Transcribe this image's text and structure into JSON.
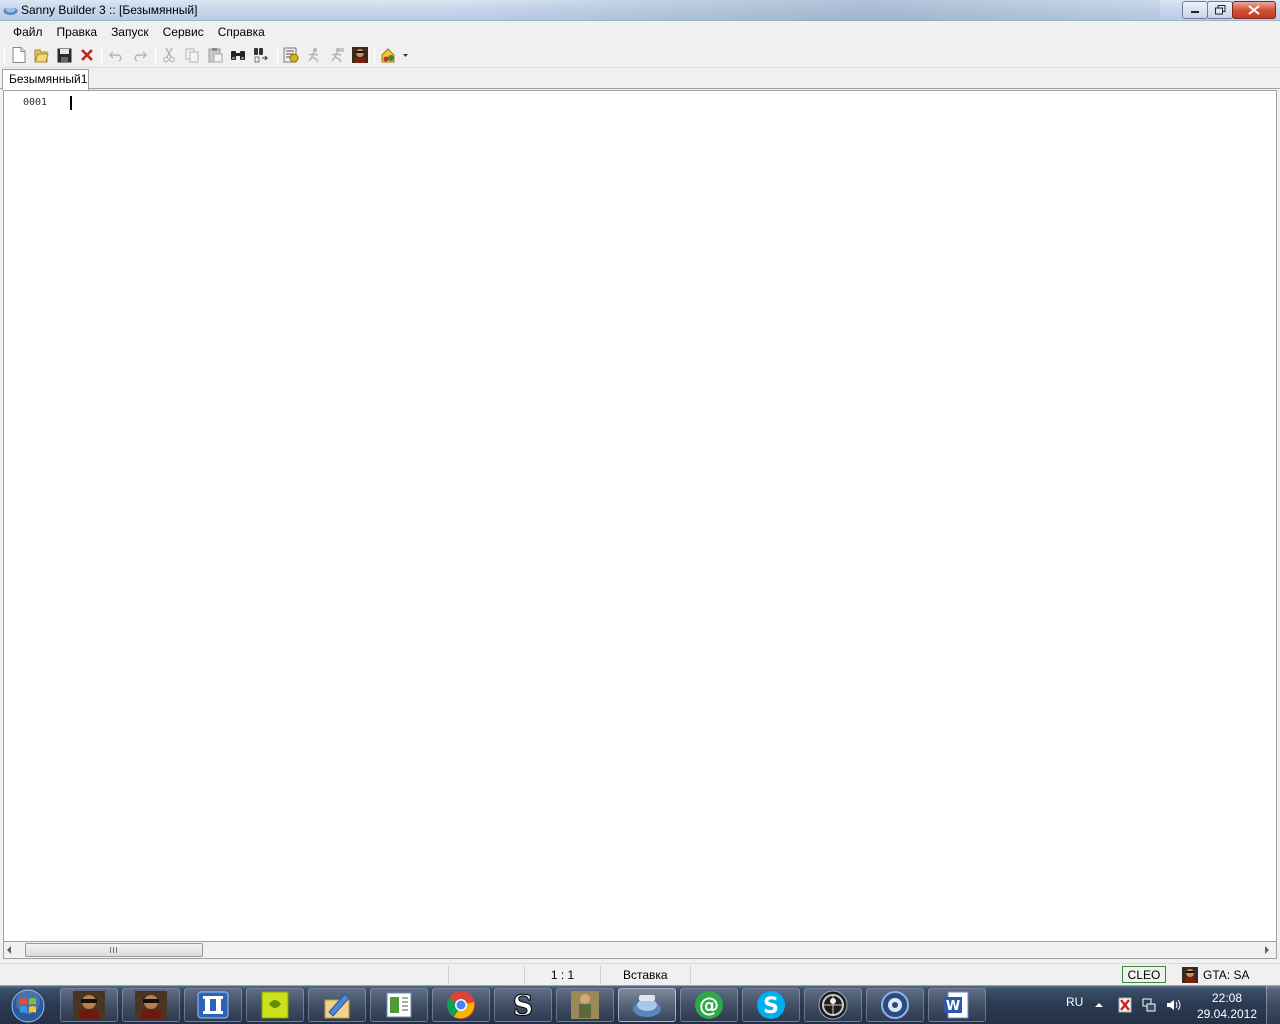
{
  "window": {
    "title": "Sanny Builder 3 :: [Безымянный]"
  },
  "menu": {
    "items": [
      "Файл",
      "Правка",
      "Запуск",
      "Сервис",
      "Справка"
    ]
  },
  "toolbar": {
    "buttons": [
      {
        "icon": "new-file-icon"
      },
      {
        "icon": "open-folder-icon"
      },
      {
        "icon": "save-icon"
      },
      {
        "icon": "close-file-icon"
      },
      {
        "icon": "undo-icon"
      },
      {
        "icon": "redo-icon"
      },
      {
        "icon": "cut-icon"
      },
      {
        "icon": "copy-icon"
      },
      {
        "icon": "paste-icon"
      },
      {
        "icon": "find-icon"
      },
      {
        "icon": "replace-icon"
      },
      {
        "icon": "compile-icon"
      },
      {
        "icon": "run-icon"
      },
      {
        "icon": "run-game-icon"
      },
      {
        "icon": "game-icon"
      },
      {
        "icon": "tools-dropdown-icon"
      }
    ]
  },
  "tabs": [
    {
      "label": "Безымянный1",
      "active": true
    }
  ],
  "editor": {
    "line_numbers": [
      "0001"
    ],
    "content": ""
  },
  "statusbar": {
    "cursor_position": "1 :  1",
    "mode": "Вставка",
    "cleo_badge": "CLEO",
    "game": "GTA: SA"
  },
  "taskbar": {
    "apps": [
      {
        "icon": "gta-sa-icon",
        "active": false
      },
      {
        "icon": "gta-sa-icon",
        "active": false
      },
      {
        "icon": "total-commander-icon",
        "active": false
      },
      {
        "icon": "sticker-app-icon",
        "active": false
      },
      {
        "icon": "paint-brush-icon",
        "active": false
      },
      {
        "icon": "document-viewer-icon",
        "active": false
      },
      {
        "icon": "chrome-icon",
        "active": false
      },
      {
        "icon": "samp-icon",
        "active": false
      },
      {
        "icon": "character-game-icon",
        "active": false
      },
      {
        "icon": "sanny-builder-icon",
        "active": true
      },
      {
        "icon": "mail-agent-icon",
        "active": false
      },
      {
        "icon": "skype-icon",
        "active": false
      },
      {
        "icon": "counter-strike-icon",
        "active": false
      },
      {
        "icon": "media-player-icon",
        "active": false
      },
      {
        "icon": "word-icon",
        "active": false
      }
    ],
    "language": "RU",
    "clock_time": "22:08",
    "clock_date": "29.04.2012"
  },
  "colors": {
    "accent_close": "#c23a23",
    "cleo_border": "#3a8a3a",
    "taskbar": "#2b3a52"
  }
}
